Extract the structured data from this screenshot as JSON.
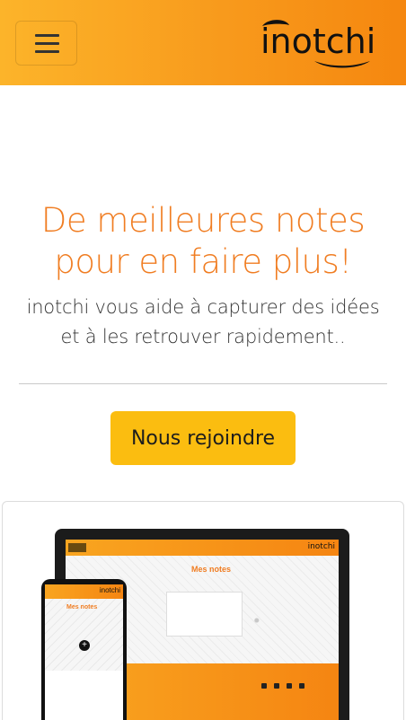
{
  "navbar": {
    "toggle_icon": "hamburger-icon",
    "logo_text": "inotchi",
    "brand_colors": {
      "gradient_start": "#fcb42a",
      "gradient_end": "#f5870f"
    }
  },
  "hero": {
    "title_line1": "De meilleures notes",
    "title_line2": "pour en faire plus!",
    "subtitle_line1": "inotchi vous aide à capturer des idées",
    "subtitle_line2": "et à les retrouver rapidement..",
    "cta_label": "Nous rejoindre",
    "title_color": "#f07d22",
    "cta_color": "#fbbd10"
  },
  "preview": {
    "laptop_title": "Mes notes",
    "laptop_logo": "inotchi",
    "phone_title": "Mes notes",
    "phone_logo": "inotchi"
  }
}
